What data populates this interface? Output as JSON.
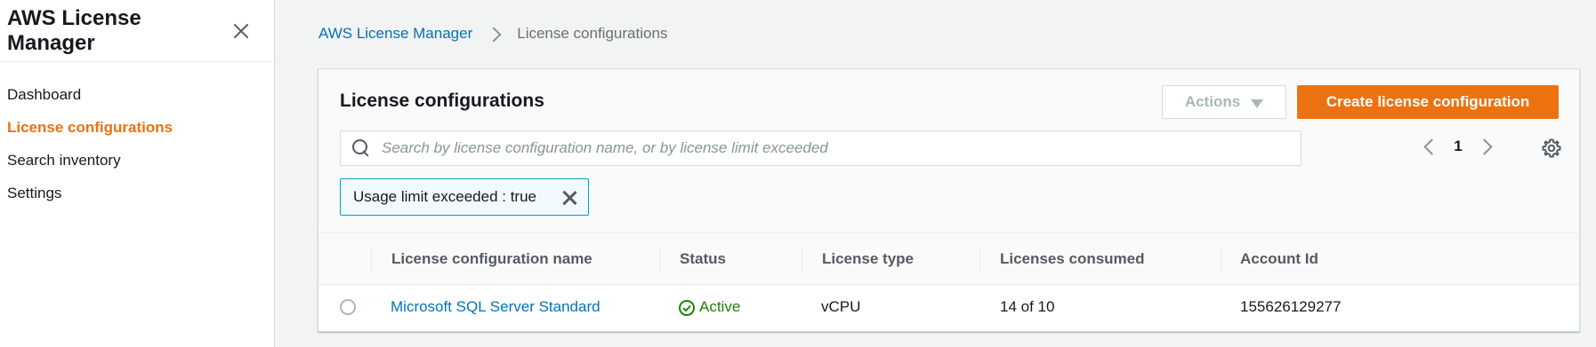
{
  "sidebar": {
    "title": "AWS License Manager",
    "items": [
      {
        "label": "Dashboard"
      },
      {
        "label": "License configurations"
      },
      {
        "label": "Search inventory"
      },
      {
        "label": "Settings"
      }
    ],
    "active_index": 1
  },
  "breadcrumb": {
    "root": "AWS License Manager",
    "current": "License configurations"
  },
  "panel": {
    "title": "License configurations",
    "actions_label": "Actions",
    "create_label": "Create license configuration",
    "search": {
      "placeholder": "Search by license configuration name, or by license limit exceeded",
      "value": ""
    },
    "pagination": {
      "current_page": "1"
    },
    "filter_token": "Usage limit exceeded : true"
  },
  "table": {
    "columns": [
      "License configuration name",
      "Status",
      "License type",
      "Licenses consumed",
      "Account Id"
    ],
    "rows": [
      {
        "name": "Microsoft SQL Server Standard",
        "status": "Active",
        "license_type": "vCPU",
        "consumed": "14 of 10",
        "account_id": "155626129277"
      }
    ]
  },
  "colors": {
    "accent": "#ec7211",
    "link": "#0073bb",
    "status_active": "#1d8102",
    "token_border": "#00a1c9"
  },
  "icons": {
    "close": "close-icon",
    "search": "search-icon",
    "settings": "gear-icon",
    "status": "check-circle-icon",
    "caret": "caret-down-icon"
  }
}
